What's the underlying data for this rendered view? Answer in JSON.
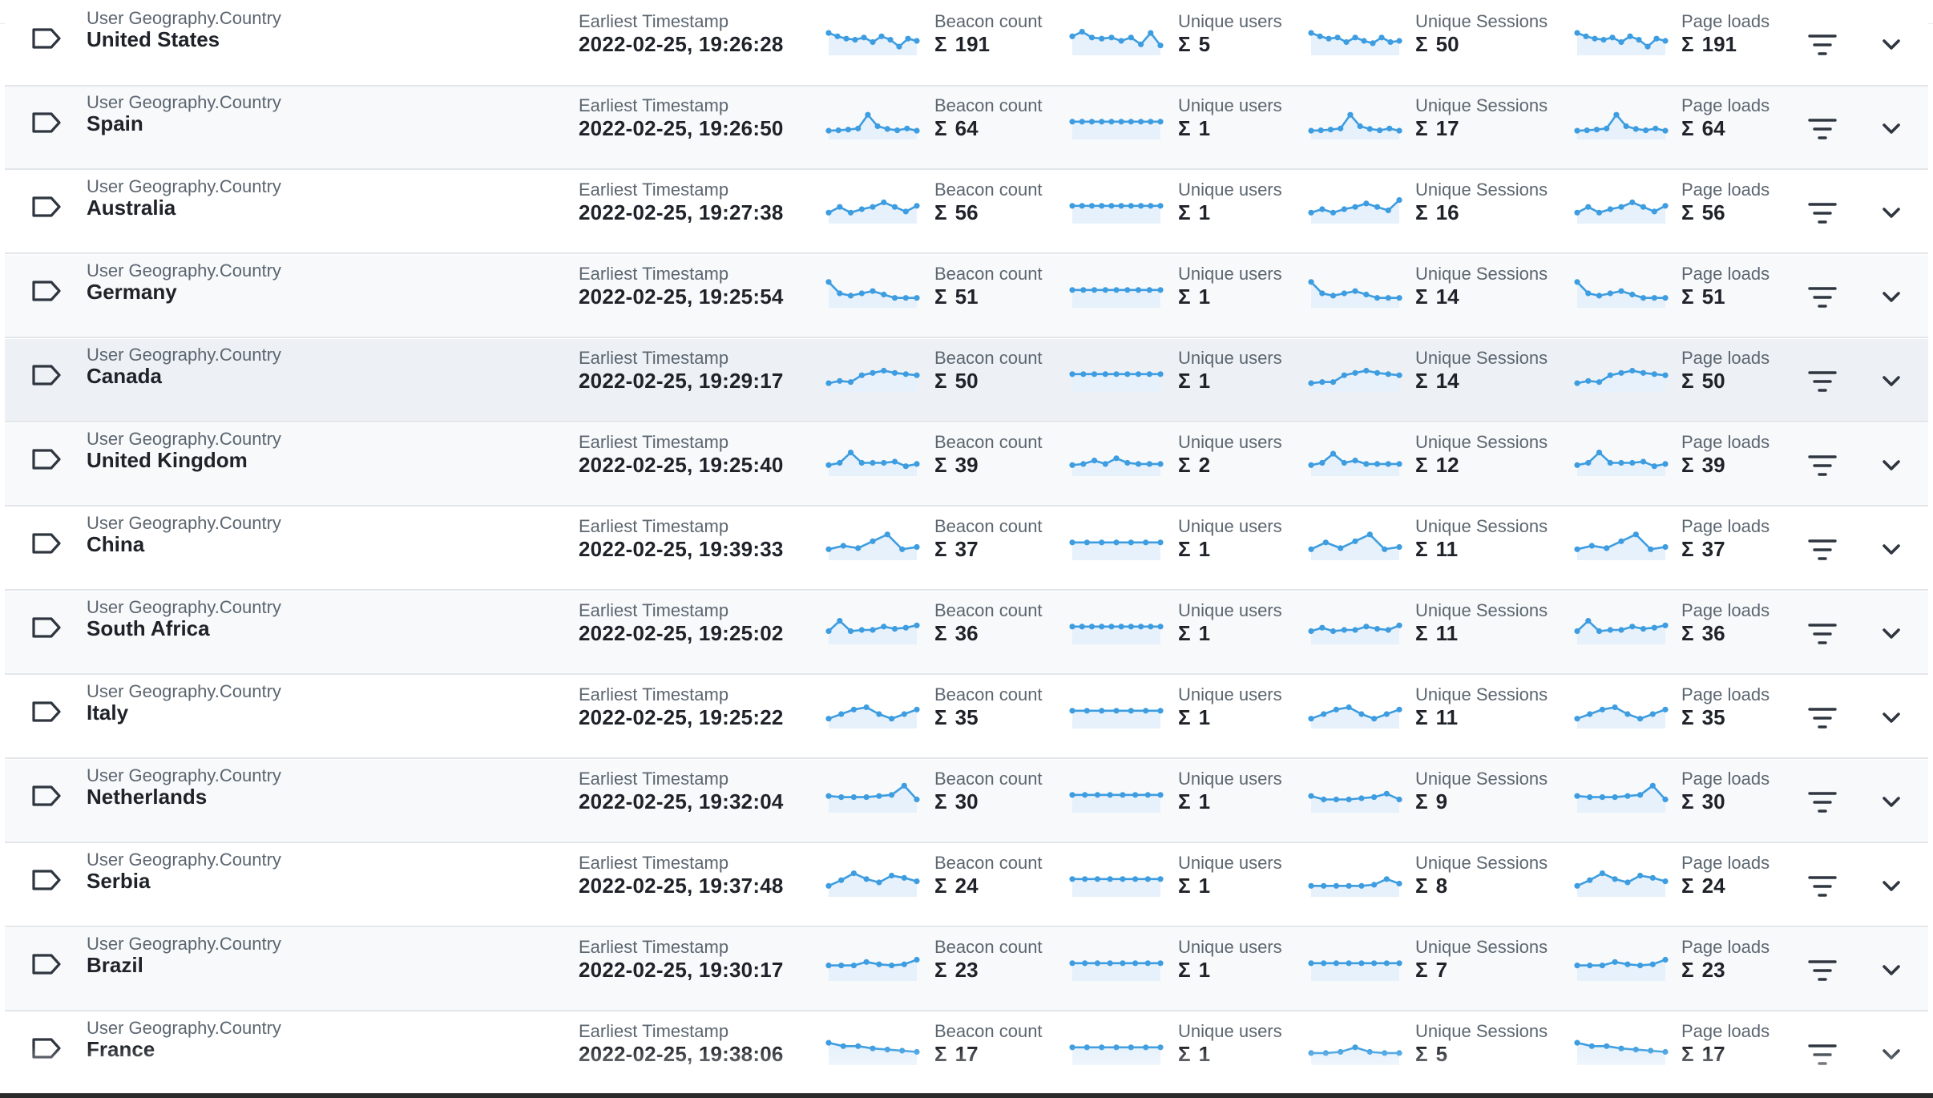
{
  "colors": {
    "spark_line": "#3d9de0",
    "spark_fill": "#e6f1fb",
    "label": "#5c6670",
    "value": "#1f2329",
    "row_alt": "#f7f9fb",
    "row_hover": "#edf1f5",
    "icon": "#2f3640"
  },
  "icons": {
    "tag": "tag-outline-icon",
    "filter": "filter-lines-icon",
    "expand": "chevron-down-icon"
  },
  "labels": {
    "dimension": "User Geography.Country",
    "timestamp": "Earliest Timestamp",
    "beacon": "Beacon count",
    "users": "Unique users",
    "sessions": "Unique Sessions",
    "loads": "Page loads",
    "sum_symbol": "Σ"
  },
  "rows": [
    {
      "country": "United States",
      "timestamp": "2022-02-25, 19:26:28",
      "beacon": "191",
      "users": "5",
      "sessions": "50",
      "loads": "191",
      "spark": {
        "beacon": [
          0.7,
          0.55,
          0.45,
          0.4,
          0.5,
          0.3,
          0.55,
          0.4,
          0.1,
          0.45,
          0.35
        ],
        "users": [
          0.55,
          0.75,
          0.5,
          0.45,
          0.5,
          0.35,
          0.5,
          0.2,
          0.7,
          0.15
        ],
        "sessions": [
          0.7,
          0.55,
          0.45,
          0.5,
          0.3,
          0.5,
          0.35,
          0.25,
          0.5,
          0.3,
          0.35
        ],
        "loads": [
          0.7,
          0.55,
          0.45,
          0.4,
          0.5,
          0.3,
          0.55,
          0.4,
          0.1,
          0.45,
          0.35
        ]
      }
    },
    {
      "country": "Spain",
      "timestamp": "2022-02-25, 19:26:50",
      "beacon": "64",
      "users": "1",
      "sessions": "17",
      "loads": "64",
      "spark": {
        "beacon": [
          0.1,
          0.12,
          0.15,
          0.2,
          0.8,
          0.3,
          0.18,
          0.12,
          0.2,
          0.1
        ],
        "users": [
          0.5,
          0.5,
          0.5,
          0.5,
          0.5,
          0.5,
          0.5,
          0.5,
          0.5,
          0.5
        ],
        "sessions": [
          0.1,
          0.12,
          0.15,
          0.2,
          0.8,
          0.3,
          0.18,
          0.12,
          0.2,
          0.1
        ],
        "loads": [
          0.1,
          0.12,
          0.15,
          0.2,
          0.8,
          0.3,
          0.18,
          0.12,
          0.2,
          0.1
        ]
      }
    },
    {
      "country": "Australia",
      "timestamp": "2022-02-25, 19:27:38",
      "beacon": "56",
      "users": "1",
      "sessions": "16",
      "loads": "56",
      "spark": {
        "beacon": [
          0.2,
          0.45,
          0.2,
          0.35,
          0.45,
          0.65,
          0.45,
          0.25,
          0.5
        ],
        "users": [
          0.5,
          0.5,
          0.5,
          0.5,
          0.5,
          0.5,
          0.5,
          0.5,
          0.5,
          0.5
        ],
        "sessions": [
          0.2,
          0.35,
          0.2,
          0.35,
          0.45,
          0.6,
          0.45,
          0.3,
          0.75
        ],
        "loads": [
          0.2,
          0.45,
          0.2,
          0.35,
          0.45,
          0.65,
          0.45,
          0.25,
          0.5
        ]
      }
    },
    {
      "country": "Germany",
      "timestamp": "2022-02-25, 19:25:54",
      "beacon": "51",
      "users": "1",
      "sessions": "14",
      "loads": "51",
      "spark": {
        "beacon": [
          0.85,
          0.35,
          0.25,
          0.35,
          0.45,
          0.3,
          0.15,
          0.15,
          0.15
        ],
        "users": [
          0.5,
          0.5,
          0.5,
          0.5,
          0.5,
          0.5,
          0.5,
          0.5,
          0.5
        ],
        "sessions": [
          0.85,
          0.35,
          0.25,
          0.35,
          0.45,
          0.3,
          0.15,
          0.15,
          0.15
        ],
        "loads": [
          0.85,
          0.35,
          0.25,
          0.35,
          0.45,
          0.3,
          0.15,
          0.15,
          0.15
        ]
      }
    },
    {
      "country": "Canada",
      "timestamp": "2022-02-25, 19:29:17",
      "beacon": "50",
      "users": "1",
      "sessions": "14",
      "loads": "50",
      "spark": {
        "beacon": [
          0.1,
          0.2,
          0.15,
          0.45,
          0.55,
          0.65,
          0.55,
          0.5,
          0.45
        ],
        "users": [
          0.5,
          0.5,
          0.5,
          0.5,
          0.5,
          0.5,
          0.5,
          0.5,
          0.5
        ],
        "sessions": [
          0.1,
          0.15,
          0.15,
          0.45,
          0.55,
          0.65,
          0.55,
          0.5,
          0.45
        ],
        "loads": [
          0.1,
          0.2,
          0.15,
          0.45,
          0.55,
          0.65,
          0.55,
          0.5,
          0.45
        ]
      }
    },
    {
      "country": "United Kingdom",
      "timestamp": "2022-02-25, 19:25:40",
      "beacon": "39",
      "users": "2",
      "sessions": "12",
      "loads": "39",
      "spark": {
        "beacon": [
          0.2,
          0.3,
          0.75,
          0.3,
          0.3,
          0.3,
          0.35,
          0.15,
          0.25
        ],
        "users": [
          0.2,
          0.25,
          0.4,
          0.25,
          0.5,
          0.3,
          0.25,
          0.25,
          0.25
        ],
        "sessions": [
          0.2,
          0.3,
          0.7,
          0.3,
          0.4,
          0.25,
          0.25,
          0.25,
          0.25
        ],
        "loads": [
          0.2,
          0.3,
          0.75,
          0.3,
          0.3,
          0.3,
          0.35,
          0.15,
          0.25
        ]
      }
    },
    {
      "country": "China",
      "timestamp": "2022-02-25, 19:39:33",
      "beacon": "37",
      "users": "1",
      "sessions": "11",
      "loads": "37",
      "spark": {
        "beacon": [
          0.2,
          0.35,
          0.25,
          0.55,
          0.85,
          0.2,
          0.3
        ],
        "users": [
          0.5,
          0.5,
          0.5,
          0.5,
          0.5,
          0.5,
          0.5
        ],
        "sessions": [
          0.2,
          0.5,
          0.25,
          0.55,
          0.85,
          0.2,
          0.3
        ],
        "loads": [
          0.2,
          0.35,
          0.25,
          0.55,
          0.85,
          0.2,
          0.3
        ]
      }
    },
    {
      "country": "South Africa",
      "timestamp": "2022-02-25, 19:25:02",
      "beacon": "36",
      "users": "1",
      "sessions": "11",
      "loads": "36",
      "spark": {
        "beacon": [
          0.3,
          0.75,
          0.3,
          0.35,
          0.35,
          0.5,
          0.4,
          0.45,
          0.55
        ],
        "users": [
          0.5,
          0.5,
          0.5,
          0.5,
          0.5,
          0.5,
          0.5,
          0.5,
          0.5,
          0.5
        ],
        "sessions": [
          0.3,
          0.45,
          0.3,
          0.35,
          0.35,
          0.5,
          0.4,
          0.35,
          0.55
        ],
        "loads": [
          0.3,
          0.75,
          0.3,
          0.35,
          0.35,
          0.5,
          0.4,
          0.45,
          0.55
        ]
      }
    },
    {
      "country": "Italy",
      "timestamp": "2022-02-25, 19:25:22",
      "beacon": "35",
      "users": "1",
      "sessions": "11",
      "loads": "35",
      "spark": {
        "beacon": [
          0.15,
          0.35,
          0.55,
          0.65,
          0.35,
          0.15,
          0.35,
          0.55
        ],
        "users": [
          0.5,
          0.5,
          0.5,
          0.5,
          0.5,
          0.5,
          0.5
        ],
        "sessions": [
          0.15,
          0.35,
          0.55,
          0.65,
          0.35,
          0.15,
          0.35,
          0.55
        ],
        "loads": [
          0.15,
          0.35,
          0.55,
          0.65,
          0.35,
          0.15,
          0.35,
          0.55
        ]
      }
    },
    {
      "country": "Netherlands",
      "timestamp": "2022-02-25, 19:32:04",
      "beacon": "30",
      "users": "1",
      "sessions": "9",
      "loads": "30",
      "spark": {
        "beacon": [
          0.45,
          0.4,
          0.4,
          0.4,
          0.45,
          0.5,
          0.9,
          0.3
        ],
        "users": [
          0.5,
          0.5,
          0.5,
          0.5,
          0.5,
          0.5,
          0.5,
          0.5
        ],
        "sessions": [
          0.45,
          0.3,
          0.3,
          0.3,
          0.35,
          0.4,
          0.55,
          0.3
        ],
        "loads": [
          0.45,
          0.4,
          0.4,
          0.4,
          0.45,
          0.5,
          0.9,
          0.3
        ]
      }
    },
    {
      "country": "Serbia",
      "timestamp": "2022-02-25, 19:37:48",
      "beacon": "24",
      "users": "1",
      "sessions": "8",
      "loads": "24",
      "spark": {
        "beacon": [
          0.2,
          0.45,
          0.75,
          0.5,
          0.35,
          0.65,
          0.55,
          0.4
        ],
        "users": [
          0.5,
          0.5,
          0.5,
          0.5,
          0.5,
          0.5,
          0.5,
          0.5
        ],
        "sessions": [
          0.2,
          0.2,
          0.2,
          0.2,
          0.2,
          0.25,
          0.5,
          0.3
        ],
        "loads": [
          0.2,
          0.45,
          0.75,
          0.5,
          0.35,
          0.65,
          0.55,
          0.4
        ]
      }
    },
    {
      "country": "Brazil",
      "timestamp": "2022-02-25, 19:30:17",
      "beacon": "23",
      "users": "1",
      "sessions": "7",
      "loads": "23",
      "spark": {
        "beacon": [
          0.4,
          0.4,
          0.4,
          0.55,
          0.45,
          0.4,
          0.45,
          0.65
        ],
        "users": [
          0.5,
          0.5,
          0.5,
          0.5,
          0.5,
          0.5,
          0.5,
          0.5
        ],
        "sessions": [
          0.5,
          0.5,
          0.5,
          0.5,
          0.5,
          0.5,
          0.5,
          0.5
        ],
        "loads": [
          0.4,
          0.4,
          0.4,
          0.55,
          0.45,
          0.4,
          0.45,
          0.65
        ]
      }
    },
    {
      "country": "France",
      "timestamp": "2022-02-25, 19:38:06",
      "beacon": "17",
      "users": "1",
      "sessions": "5",
      "loads": "17",
      "spark": {
        "beacon": [
          0.7,
          0.55,
          0.55,
          0.45,
          0.4,
          0.35,
          0.3
        ],
        "users": [
          0.5,
          0.5,
          0.5,
          0.5,
          0.5,
          0.5,
          0.5
        ],
        "sessions": [
          0.25,
          0.25,
          0.3,
          0.5,
          0.3,
          0.25,
          0.25
        ],
        "loads": [
          0.7,
          0.55,
          0.55,
          0.45,
          0.4,
          0.35,
          0.3
        ]
      }
    }
  ]
}
